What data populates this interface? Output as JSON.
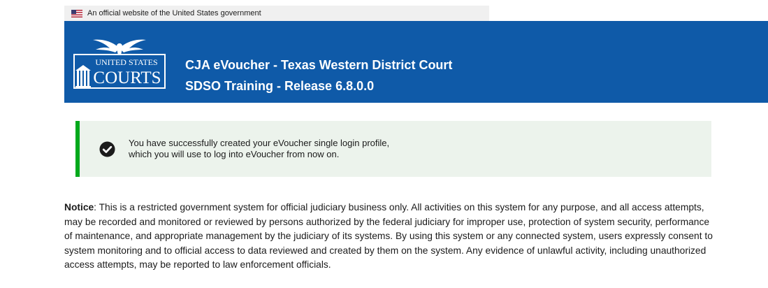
{
  "gov_banner": {
    "text": "An official website of the United States government"
  },
  "header": {
    "logo": {
      "line1": "UNITED STATES",
      "line2": "COURTS"
    },
    "title_line1": "CJA eVoucher - Texas Western District Court",
    "title_line2": "SDSO Training - Release 6.8.0.0",
    "background_color": "#0f5aa8"
  },
  "alert": {
    "icon": "check-circle-icon",
    "line1": "You have successfully created your eVoucher single login profile,",
    "line2": "which you will use to log into eVoucher from now on.",
    "accent_color": "#00a91c"
  },
  "notice": {
    "label": "Notice",
    "text": ": This is a restricted government system for official judiciary business only. All activities on this system for any purpose, and all access attempts, may be recorded and monitored or reviewed by persons authorized by the federal judiciary for improper use, protection of system security, performance of maintenance, and appropriate management by the judiciary of its systems. By using this system or any connected system, users expressly consent to system monitoring and to official access to data reviewed and created by them on the system. Any evidence of unlawful activity, including unauthorized access attempts, may be reported to law enforcement officials."
  }
}
